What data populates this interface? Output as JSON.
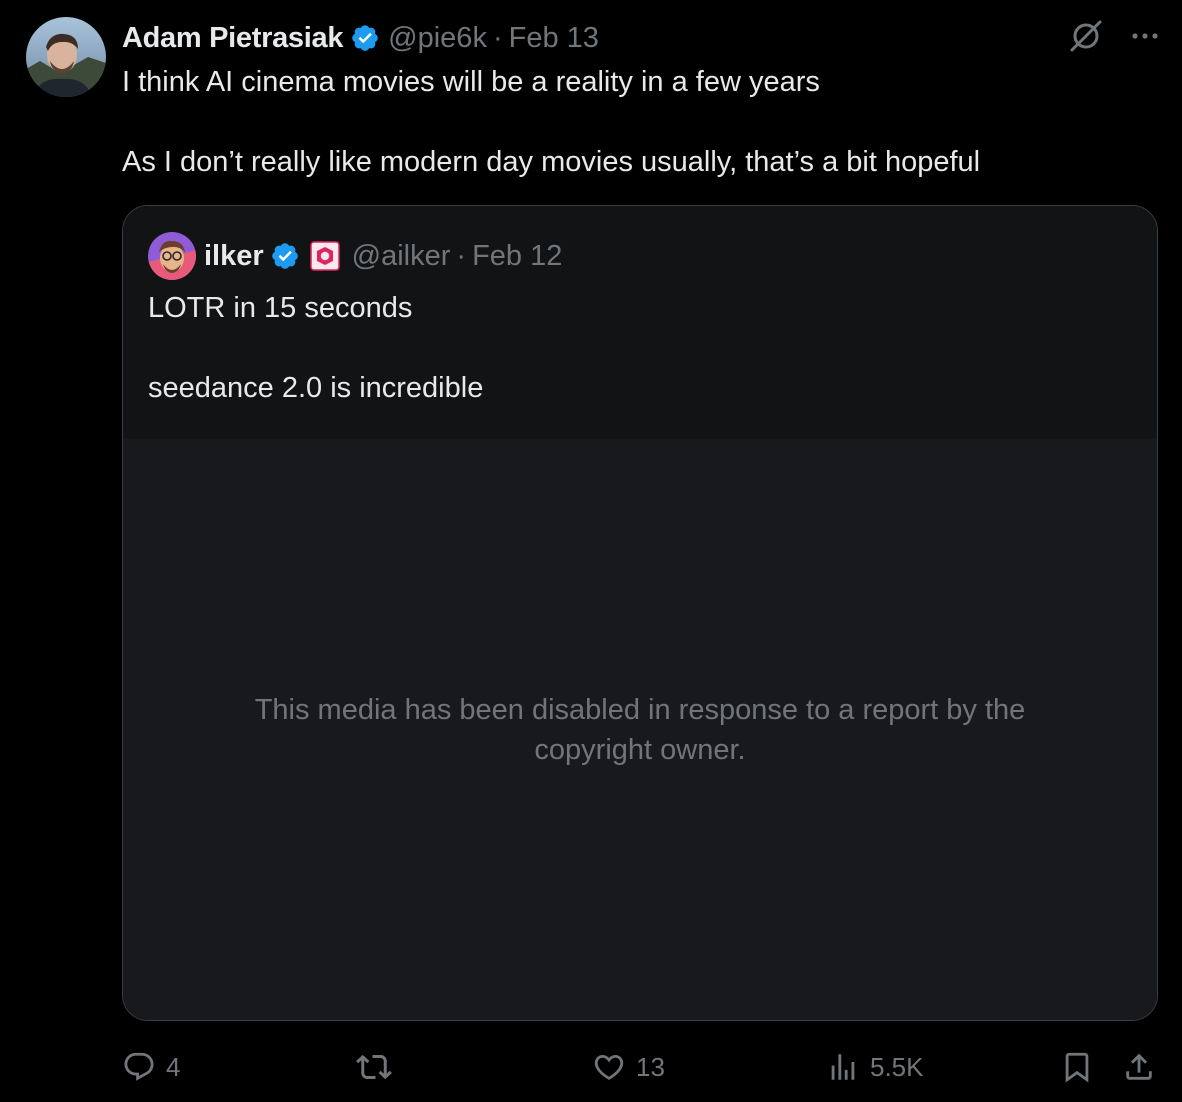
{
  "tweet": {
    "author_name": "Adam Pietrasiak",
    "handle": "@pie6k",
    "separator": "·",
    "date": "Feb 13",
    "text_lines": [
      "I think AI cinema movies will be a reality in a few years",
      "As I don’t really like modern day movies usually, that’s a bit hopeful"
    ]
  },
  "quote": {
    "author_name": "ilker",
    "handle": "@ailker",
    "separator": "·",
    "date": "Feb 12",
    "text_lines": [
      "LOTR in 15 seconds",
      "seedance 2.0 is incredible"
    ],
    "media_notice": "This media has been disabled in response to a report by the copyright owner."
  },
  "actions": {
    "replies": "4",
    "reposts": "",
    "likes": "13",
    "views": "5.5K"
  },
  "colors": {
    "background": "#000000",
    "text_primary": "#e7e9ea",
    "text_secondary": "#71767b",
    "verified_blue": "#1d9bf0",
    "quote_border": "#3a3d41",
    "media_bg": "#18191d"
  },
  "icons": [
    "verified-badge-icon",
    "grok-icon",
    "more-icon",
    "affiliate-badge-icon",
    "reply-icon",
    "repost-icon",
    "like-icon",
    "views-icon",
    "bookmark-icon",
    "share-icon"
  ]
}
